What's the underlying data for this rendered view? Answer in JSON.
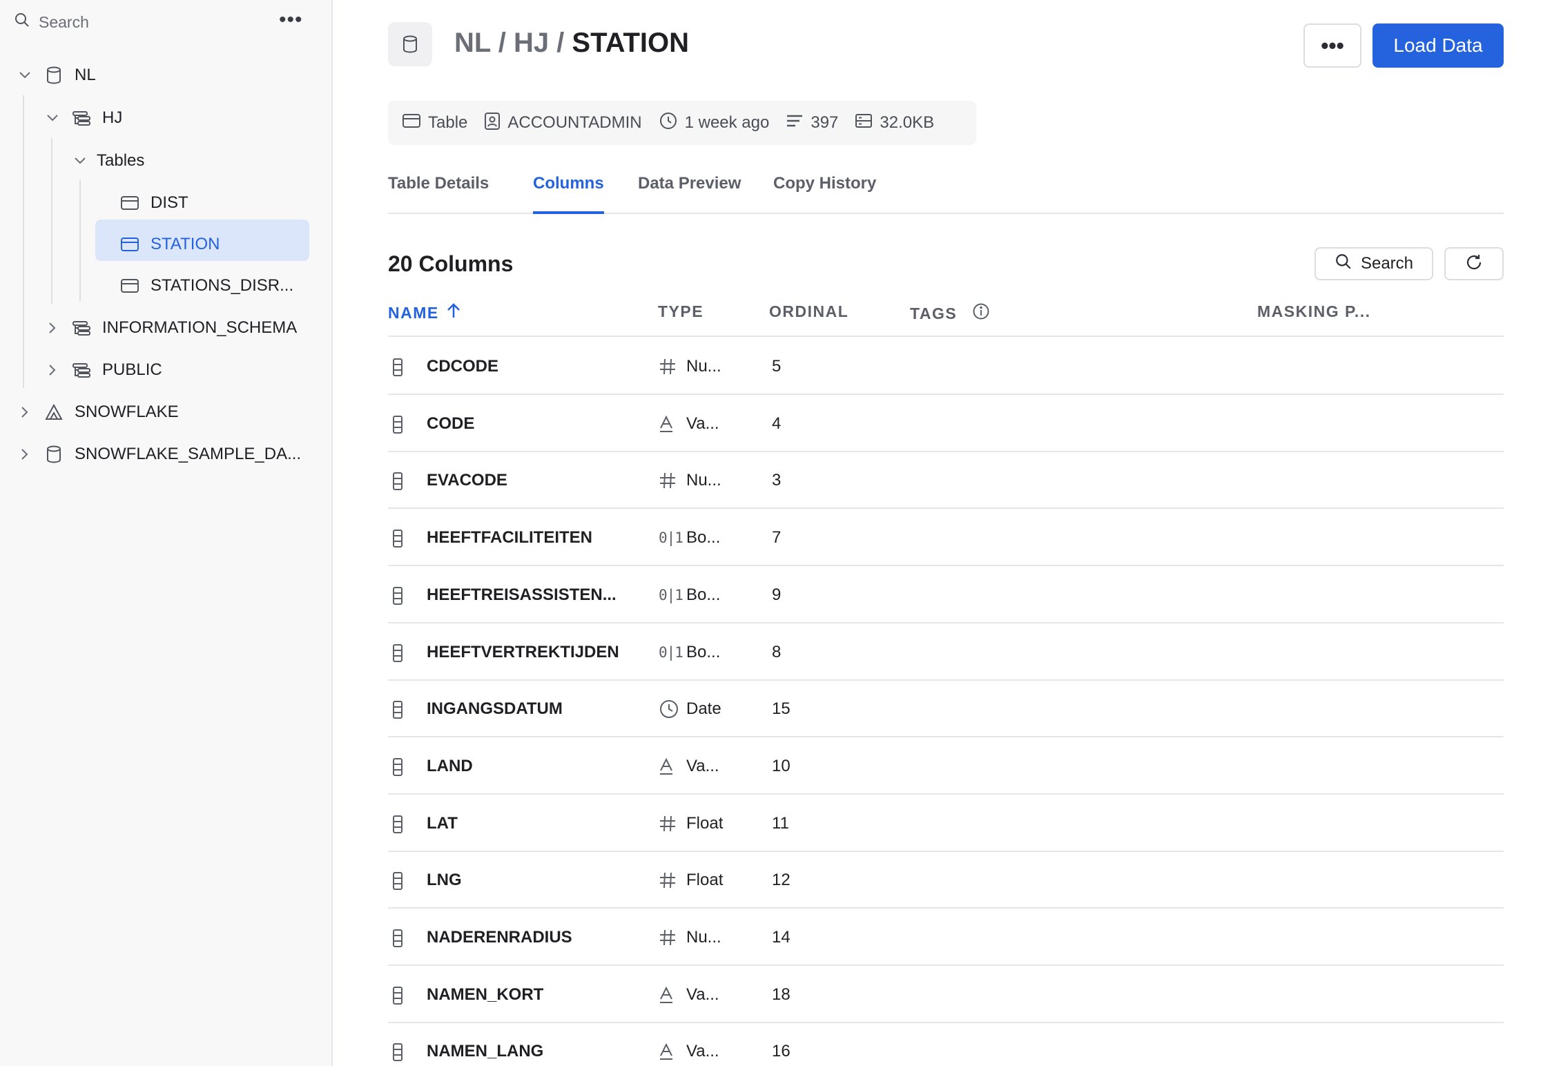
{
  "sidebar": {
    "search_placeholder": "Search",
    "more_label": "•••",
    "tree": [
      {
        "label": "NL",
        "icon": "database-icon",
        "chevron": "down"
      },
      {
        "label": "HJ",
        "icon": "schema-icon",
        "chevron": "down"
      },
      {
        "label": "Tables",
        "icon": "",
        "chevron": "down"
      },
      {
        "label": "DIST",
        "icon": "table-icon",
        "chevron": ""
      },
      {
        "label": "STATION",
        "icon": "table-icon",
        "chevron": "",
        "selected": true
      },
      {
        "label": "STATIONS_DISR...",
        "icon": "table-icon",
        "chevron": ""
      },
      {
        "label": "INFORMATION_SCHEMA",
        "icon": "schema-icon",
        "chevron": "right"
      },
      {
        "label": "PUBLIC",
        "icon": "schema-icon",
        "chevron": "right"
      },
      {
        "label": "SNOWFLAKE",
        "icon": "snowflake-app-icon",
        "chevron": "right"
      },
      {
        "label": "SNOWFLAKE_SAMPLE_DA...",
        "icon": "database-icon",
        "chevron": "right"
      }
    ]
  },
  "header": {
    "crumb_prefix": "NL / HJ / ",
    "crumb_current": "STATION",
    "more_label": "•••",
    "load_label": "Load Data"
  },
  "meta": {
    "type": "Table",
    "owner": "ACCOUNTADMIN",
    "modified": "1 week ago",
    "rows": "397",
    "size": "32.0KB"
  },
  "tabs": [
    "Table Details",
    "Columns",
    "Data Preview",
    "Copy History"
  ],
  "active_tab": "Columns",
  "columns_panel": {
    "title": "20 Columns",
    "search_label": "Search",
    "headers": {
      "name": "NAME",
      "type": "TYPE",
      "ordinal": "ORDINAL",
      "tags": "TAGS",
      "masking": "MASKING P..."
    }
  },
  "rows": [
    {
      "name": "CDCODE",
      "type_icon": "number-icon",
      "type": "Nu...",
      "ordinal": "5"
    },
    {
      "name": "CODE",
      "type_icon": "text-icon",
      "type": "Va...",
      "ordinal": "4"
    },
    {
      "name": "EVACODE",
      "type_icon": "number-icon",
      "type": "Nu...",
      "ordinal": "3"
    },
    {
      "name": "HEEFTFACILITEITEN",
      "type_icon": "boolean-icon",
      "type": "Bo...",
      "ordinal": "7"
    },
    {
      "name": "HEEFTREISASSISTEN...",
      "type_icon": "boolean-icon",
      "type": "Bo...",
      "ordinal": "9"
    },
    {
      "name": "HEEFTVERTREKTIJDEN",
      "type_icon": "boolean-icon",
      "type": "Bo...",
      "ordinal": "8"
    },
    {
      "name": "INGANGSDATUM",
      "type_icon": "date-icon",
      "type": "Date",
      "ordinal": "15"
    },
    {
      "name": "LAND",
      "type_icon": "text-icon",
      "type": "Va...",
      "ordinal": "10"
    },
    {
      "name": "LAT",
      "type_icon": "number-icon",
      "type": "Float",
      "ordinal": "11"
    },
    {
      "name": "LNG",
      "type_icon": "number-icon",
      "type": "Float",
      "ordinal": "12"
    },
    {
      "name": "NADERENRADIUS",
      "type_icon": "number-icon",
      "type": "Nu...",
      "ordinal": "14"
    },
    {
      "name": "NAMEN_KORT",
      "type_icon": "text-icon",
      "type": "Va...",
      "ordinal": "18"
    },
    {
      "name": "NAMEN_LANG",
      "type_icon": "text-icon",
      "type": "Va...",
      "ordinal": "16"
    }
  ],
  "colors": {
    "accent": "#2563de",
    "selected_bg": "#dbe6fb",
    "sidebar_bg": "#f8f8f9"
  }
}
